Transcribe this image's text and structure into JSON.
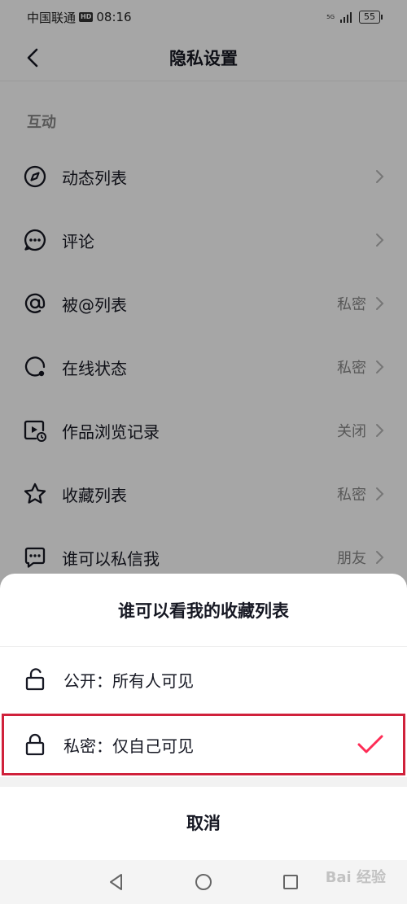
{
  "status_bar": {
    "carrier": "中国联通",
    "hd": "HD",
    "time": "08:16",
    "network": "5G",
    "battery": "55"
  },
  "nav": {
    "title": "隐私设置"
  },
  "section": {
    "title": "互动"
  },
  "settings": [
    {
      "label": "动态列表",
      "value": "",
      "icon": "compass-icon"
    },
    {
      "label": "评论",
      "value": "",
      "icon": "comment-icon"
    },
    {
      "label": "被@列表",
      "value": "私密",
      "icon": "at-icon"
    },
    {
      "label": "在线状态",
      "value": "私密",
      "icon": "online-status-icon"
    },
    {
      "label": "作品浏览记录",
      "value": "关闭",
      "icon": "view-history-icon"
    },
    {
      "label": "收藏列表",
      "value": "私密",
      "icon": "star-icon"
    },
    {
      "label": "谁可以私信我",
      "value": "朋友",
      "icon": "message-icon"
    }
  ],
  "sheet": {
    "title": "谁可以看我的收藏列表",
    "options": [
      {
        "label": "公开：所有人可见",
        "icon": "unlock-icon",
        "selected": false
      },
      {
        "label": "私密：仅自己可见",
        "icon": "lock-icon",
        "selected": true
      }
    ],
    "cancel": "取消"
  },
  "watermark": "Bai 经验",
  "colors": {
    "accent": "#fe2c55",
    "highlight_border": "#d0213b",
    "text": "#161823",
    "secondary": "#888888"
  }
}
